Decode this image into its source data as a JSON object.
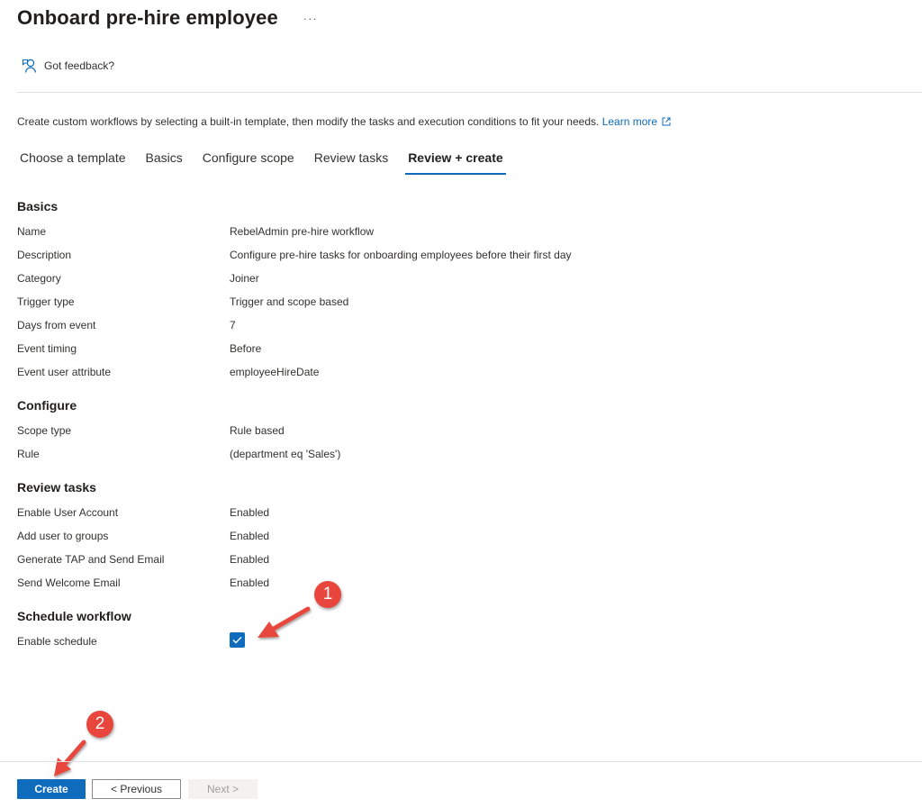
{
  "header": {
    "title": "Onboard pre-hire employee",
    "more_label": "···",
    "feedback_label": "Got feedback?"
  },
  "intro": {
    "text": "Create custom workflows by selecting a built-in template, then modify the tasks and execution conditions to fit your needs.",
    "learn_more": "Learn more"
  },
  "tabs": [
    {
      "label": "Choose a template"
    },
    {
      "label": "Basics"
    },
    {
      "label": "Configure scope"
    },
    {
      "label": "Review tasks"
    },
    {
      "label": "Review + create"
    }
  ],
  "active_tab": "Review + create",
  "sections": {
    "basics": {
      "title": "Basics",
      "rows": [
        {
          "k": "Name",
          "v": "RebelAdmin pre-hire workflow"
        },
        {
          "k": "Description",
          "v": "Configure pre-hire tasks for onboarding employees before their first day"
        },
        {
          "k": "Category",
          "v": "Joiner"
        },
        {
          "k": "Trigger type",
          "v": "Trigger and scope based"
        },
        {
          "k": "Days from event",
          "v": "7"
        },
        {
          "k": "Event timing",
          "v": "Before"
        },
        {
          "k": "Event user attribute",
          "v": "employeeHireDate"
        }
      ]
    },
    "configure": {
      "title": "Configure",
      "rows": [
        {
          "k": "Scope type",
          "v": "Rule based"
        },
        {
          "k": "Rule",
          "v": "(department eq 'Sales')"
        }
      ]
    },
    "review_tasks": {
      "title": "Review tasks",
      "rows": [
        {
          "k": "Enable User Account",
          "v": "Enabled"
        },
        {
          "k": "Add user to groups",
          "v": "Enabled"
        },
        {
          "k": "Generate TAP and Send Email",
          "v": "Enabled"
        },
        {
          "k": "Send Welcome Email",
          "v": "Enabled"
        }
      ]
    },
    "schedule": {
      "title": "Schedule workflow",
      "enable_label": "Enable schedule",
      "enabled": true
    }
  },
  "footer": {
    "create": "Create",
    "previous": "< Previous",
    "next": "Next >"
  },
  "annotations": [
    "1",
    "2"
  ],
  "colors": {
    "accent": "#0f6cbd",
    "annotation": "#e8463c"
  }
}
